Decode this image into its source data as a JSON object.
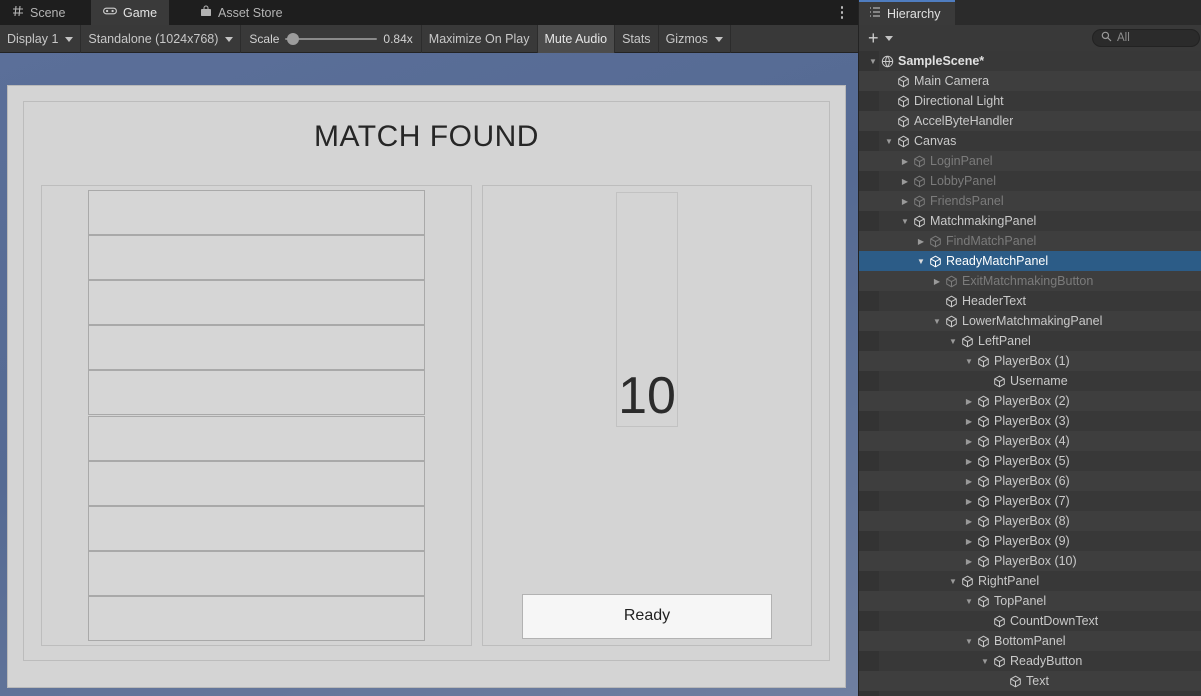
{
  "game_pane": {
    "tabs": [
      {
        "label": "Scene",
        "icon": "grid-icon",
        "active": false
      },
      {
        "label": "Game",
        "icon": "gamepad-icon",
        "active": true
      },
      {
        "label": "Asset Store",
        "icon": "store-icon",
        "active": false
      }
    ],
    "overflow_icon": "kebab-menu-icon",
    "toolbar": {
      "display": "Display 1",
      "resolution": "Standalone (1024x768)",
      "scale_label": "Scale",
      "scale_value": "0.84x",
      "maximize_on_play": "Maximize On Play",
      "mute_audio": "Mute Audio",
      "stats": "Stats",
      "gizmos": "Gizmos"
    }
  },
  "game_ui": {
    "header": "MATCH FOUND",
    "player_boxes": [
      "",
      "",
      "",
      "",
      "",
      "",
      "",
      "",
      "",
      ""
    ],
    "countdown": "10",
    "ready_button": "Ready"
  },
  "hierarchy": {
    "tab_label": "Hierarchy",
    "tab_icon": "hierarchy-icon",
    "create_label": "+",
    "search_placeholder": "All",
    "search_icon": "search-icon",
    "rows": [
      {
        "label": "SampleScene*",
        "depth": 1,
        "arrow": "down",
        "icon": "scene-icon",
        "state": "scene"
      },
      {
        "label": "Main Camera",
        "depth": 2,
        "arrow": "none",
        "icon": "gameobject-icon",
        "state": "normal"
      },
      {
        "label": "Directional Light",
        "depth": 2,
        "arrow": "none",
        "icon": "gameobject-icon",
        "state": "normal"
      },
      {
        "label": "AccelByteHandler",
        "depth": 2,
        "arrow": "none",
        "icon": "gameobject-icon",
        "state": "normal"
      },
      {
        "label": "Canvas",
        "depth": 2,
        "arrow": "down",
        "icon": "gameobject-icon",
        "state": "normal"
      },
      {
        "label": "LoginPanel",
        "depth": 3,
        "arrow": "right",
        "icon": "gameobject-icon",
        "state": "dim"
      },
      {
        "label": "LobbyPanel",
        "depth": 3,
        "arrow": "right",
        "icon": "gameobject-icon",
        "state": "dim"
      },
      {
        "label": "FriendsPanel",
        "depth": 3,
        "arrow": "right",
        "icon": "gameobject-icon",
        "state": "dim"
      },
      {
        "label": "MatchmakingPanel",
        "depth": 3,
        "arrow": "down",
        "icon": "gameobject-icon",
        "state": "normal"
      },
      {
        "label": "FindMatchPanel",
        "depth": 4,
        "arrow": "right",
        "icon": "gameobject-icon",
        "state": "dim"
      },
      {
        "label": "ReadyMatchPanel",
        "depth": 4,
        "arrow": "down",
        "icon": "gameobject-icon",
        "state": "selected"
      },
      {
        "label": "ExitMatchmakingButton",
        "depth": 5,
        "arrow": "right",
        "icon": "gameobject-icon",
        "state": "dim"
      },
      {
        "label": "HeaderText",
        "depth": 5,
        "arrow": "none",
        "icon": "gameobject-icon",
        "state": "normal"
      },
      {
        "label": "LowerMatchmakingPanel",
        "depth": 5,
        "arrow": "down",
        "icon": "gameobject-icon",
        "state": "normal"
      },
      {
        "label": "LeftPanel",
        "depth": 6,
        "arrow": "down",
        "icon": "gameobject-icon",
        "state": "normal"
      },
      {
        "label": "PlayerBox (1)",
        "depth": 7,
        "arrow": "down",
        "icon": "gameobject-icon",
        "state": "normal"
      },
      {
        "label": "Username",
        "depth": 8,
        "arrow": "none",
        "icon": "gameobject-icon",
        "state": "normal"
      },
      {
        "label": "PlayerBox (2)",
        "depth": 7,
        "arrow": "right",
        "icon": "gameobject-icon",
        "state": "normal"
      },
      {
        "label": "PlayerBox (3)",
        "depth": 7,
        "arrow": "right",
        "icon": "gameobject-icon",
        "state": "normal"
      },
      {
        "label": "PlayerBox (4)",
        "depth": 7,
        "arrow": "right",
        "icon": "gameobject-icon",
        "state": "normal"
      },
      {
        "label": "PlayerBox (5)",
        "depth": 7,
        "arrow": "right",
        "icon": "gameobject-icon",
        "state": "normal"
      },
      {
        "label": "PlayerBox (6)",
        "depth": 7,
        "arrow": "right",
        "icon": "gameobject-icon",
        "state": "normal"
      },
      {
        "label": "PlayerBox (7)",
        "depth": 7,
        "arrow": "right",
        "icon": "gameobject-icon",
        "state": "normal"
      },
      {
        "label": "PlayerBox (8)",
        "depth": 7,
        "arrow": "right",
        "icon": "gameobject-icon",
        "state": "normal"
      },
      {
        "label": "PlayerBox (9)",
        "depth": 7,
        "arrow": "right",
        "icon": "gameobject-icon",
        "state": "normal"
      },
      {
        "label": "PlayerBox (10)",
        "depth": 7,
        "arrow": "right",
        "icon": "gameobject-icon",
        "state": "normal"
      },
      {
        "label": "RightPanel",
        "depth": 6,
        "arrow": "down",
        "icon": "gameobject-icon",
        "state": "normal"
      },
      {
        "label": "TopPanel",
        "depth": 7,
        "arrow": "down",
        "icon": "gameobject-icon",
        "state": "normal"
      },
      {
        "label": "CountDownText",
        "depth": 8,
        "arrow": "none",
        "icon": "gameobject-icon",
        "state": "normal"
      },
      {
        "label": "BottomPanel",
        "depth": 7,
        "arrow": "down",
        "icon": "gameobject-icon",
        "state": "normal"
      },
      {
        "label": "ReadyButton",
        "depth": 8,
        "arrow": "down",
        "icon": "gameobject-icon",
        "state": "normal"
      },
      {
        "label": "Text",
        "depth": 9,
        "arrow": "none",
        "icon": "gameobject-icon",
        "state": "normal"
      }
    ]
  },
  "colors": {
    "selection": "#2c5c87",
    "panel_bg": "#383838",
    "game_bg": "#5a6d96",
    "ui_panel": "#d4d4d4"
  }
}
